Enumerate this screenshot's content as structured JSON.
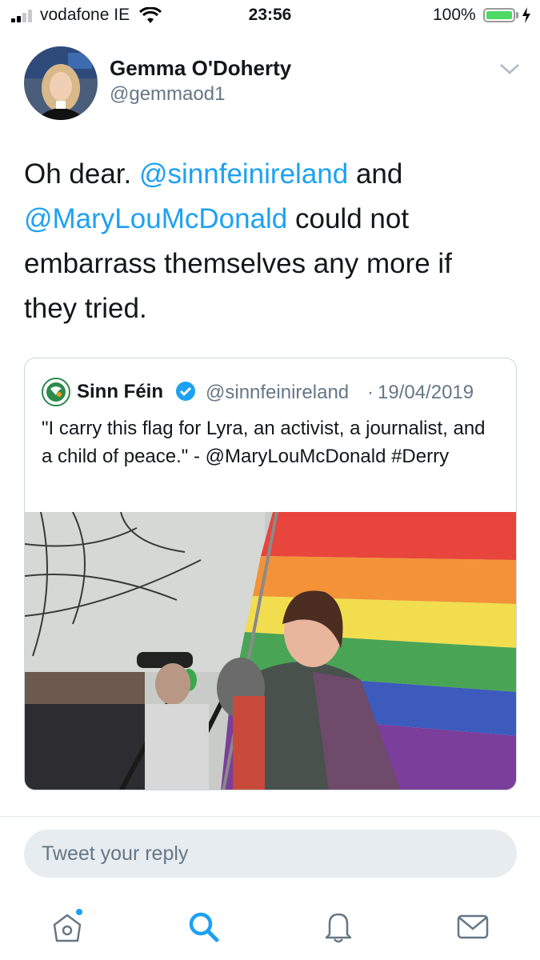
{
  "status_bar": {
    "carrier": "vodafone IE",
    "time": "23:56",
    "battery_percent": "100%",
    "battery_level": 1.0,
    "charging": true
  },
  "tweet": {
    "author_name": "Gemma O'Doherty",
    "author_handle": "@gemmaod1",
    "text_parts": {
      "p1": "Oh dear. ",
      "mention1": "@sinnfeinireland",
      "p2": " and ",
      "mention2": "@MaryLouMcDonald",
      "p3": " could not embarrass themselves any more if they tried."
    }
  },
  "quoted_tweet": {
    "name": "Sinn Féin",
    "verified": true,
    "handle": "@sinnfeinireland",
    "separator": "·",
    "date": "19/04/2019",
    "text": "\"I carry this flag for Lyra, an activist, a journalist, and a child of peace.\" - @MaryLouMcDonald #Derry"
  },
  "reply": {
    "placeholder": "Tweet your reply"
  },
  "tab_bar": {
    "items": [
      {
        "icon": "home-icon",
        "active": false,
        "has_notification_dot": true
      },
      {
        "icon": "search-icon",
        "active": true
      },
      {
        "icon": "bell-icon",
        "active": false
      },
      {
        "icon": "mail-icon",
        "active": false
      }
    ]
  },
  "colors": {
    "accent": "#1da1f2",
    "text_primary": "#14171a",
    "text_secondary": "#657786",
    "battery": "#4cd964"
  }
}
